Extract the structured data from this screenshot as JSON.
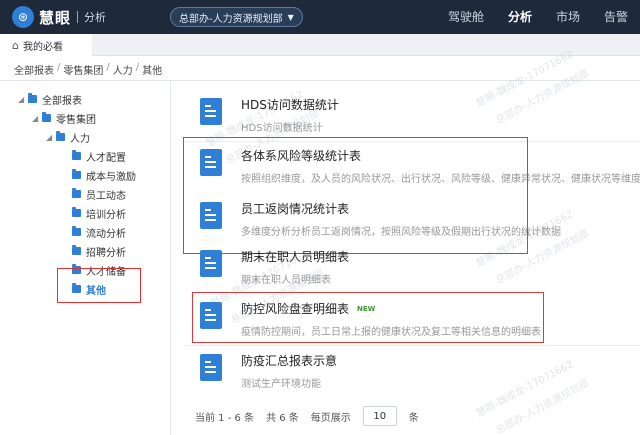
{
  "header": {
    "logo_glyph": "⊛",
    "brand": "慧眼",
    "subtitle": "分析",
    "org_selector": "总部办-人力资源规划部",
    "nav": [
      "驾驶舱",
      "分析",
      "市场",
      "告警"
    ],
    "active_nav": "分析"
  },
  "tab": {
    "label": "我的必看"
  },
  "breadcrumb": [
    "全部报表",
    "零售集团",
    "人力",
    "其他"
  ],
  "tree": [
    {
      "label": "全部报表",
      "level": 0,
      "expanded": true
    },
    {
      "label": "零售集团",
      "level": 1,
      "expanded": true
    },
    {
      "label": "人力",
      "level": 2,
      "expanded": true
    },
    {
      "label": "人才配置",
      "level": 3
    },
    {
      "label": "成本与激励",
      "level": 3
    },
    {
      "label": "员工动态",
      "level": 3
    },
    {
      "label": "培训分析",
      "level": 3
    },
    {
      "label": "流动分析",
      "level": 3
    },
    {
      "label": "招聘分析",
      "level": 3
    },
    {
      "label": "人才储备",
      "level": 3
    },
    {
      "label": "其他",
      "level": 3,
      "selected": true
    }
  ],
  "reports": [
    {
      "title": "HDS访问数据统计",
      "desc": "HDS访问数据统计",
      "new": false
    },
    {
      "title": "各体系风险等级统计表",
      "desc": "按照组织维度，及人员的风险状况、出行状况、风险等级、健康异常状况、健康状况等维度的统计",
      "new": false
    },
    {
      "title": "员工返岗情况统计表",
      "desc": "多维度分析分析员工返岗情况，按照风险等级及假期出行状况的统计数据",
      "new": false
    },
    {
      "title": "期末在职人员明细表",
      "desc": "期末在职人员明细表",
      "new": false
    },
    {
      "title": "防控风险盘查明细表",
      "desc": "疫情防控期间，员工日常上报的健康状况及复工等相关信息的明细表",
      "new": true
    },
    {
      "title": "防疫汇总报表示意",
      "desc": "测试生产环境功能",
      "new": false
    }
  ],
  "new_badge": "NEW",
  "pager": {
    "range": "当前 1 - 6 条",
    "total": "共 6 条",
    "per_page_label": "每页展示",
    "per_page_value": "10",
    "unit": "条"
  },
  "watermark": [
    "慧眼-魏成龙-17071662",
    "总部办-人力资源规划部"
  ],
  "colors": {
    "topbar": "#1e2a3a",
    "accent": "#2f7fd6",
    "highlight_box": "#d93a3a",
    "new_badge": "#3a9a2a"
  }
}
